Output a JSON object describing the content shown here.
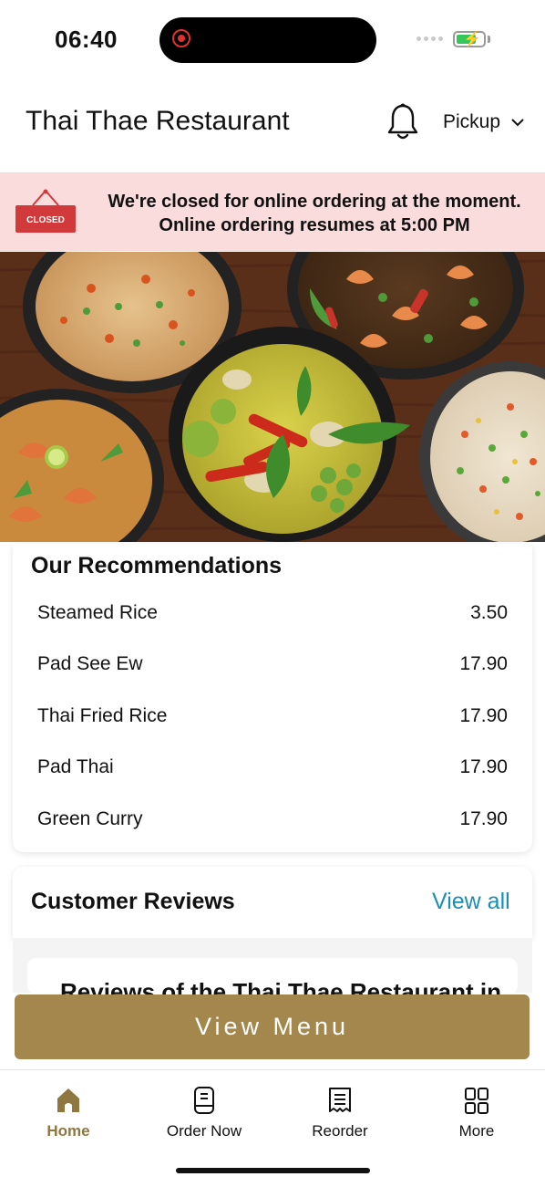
{
  "status_bar": {
    "time": "06:40",
    "battery_level": 0.75,
    "icons": [
      "record-indicator-icon",
      "signal-icon",
      "battery-charging-icon"
    ]
  },
  "header": {
    "title": "Thai Thae Restaurant",
    "pickup_label": "Pickup",
    "icons": [
      "bell-icon",
      "chevron-down-icon"
    ]
  },
  "banner": {
    "sign_text": "CLOSED",
    "line1": "We're closed for online ordering at the moment.",
    "line2": "Online ordering resumes at 5:00 PM"
  },
  "recommendations": {
    "title": "Our Recommendations",
    "items": [
      {
        "name": "Steamed Rice",
        "price": "3.50"
      },
      {
        "name": "Pad See Ew",
        "price": "17.90"
      },
      {
        "name": "Thai Fried Rice",
        "price": "17.90"
      },
      {
        "name": "Pad Thai",
        "price": "17.90"
      },
      {
        "name": "Green Curry",
        "price": "17.90"
      }
    ]
  },
  "reviews": {
    "title": "Customer Reviews",
    "view_all": "View all",
    "preview_text": "Reviews of the Thai Thae Restaurant in"
  },
  "view_menu_label": "View Menu",
  "tabs": [
    {
      "label": "Home",
      "icon": "home-icon",
      "active": true
    },
    {
      "label": "Order Now",
      "icon": "order-icon",
      "active": false
    },
    {
      "label": "Reorder",
      "icon": "receipt-icon",
      "active": false
    },
    {
      "label": "More",
      "icon": "grid-icon",
      "active": false
    }
  ],
  "colors": {
    "accent": "#a4874c",
    "active_tab": "#8f7742",
    "banner_bg": "#fadcdc",
    "link": "#1a8fb5",
    "closed_red": "#d13a3a"
  }
}
